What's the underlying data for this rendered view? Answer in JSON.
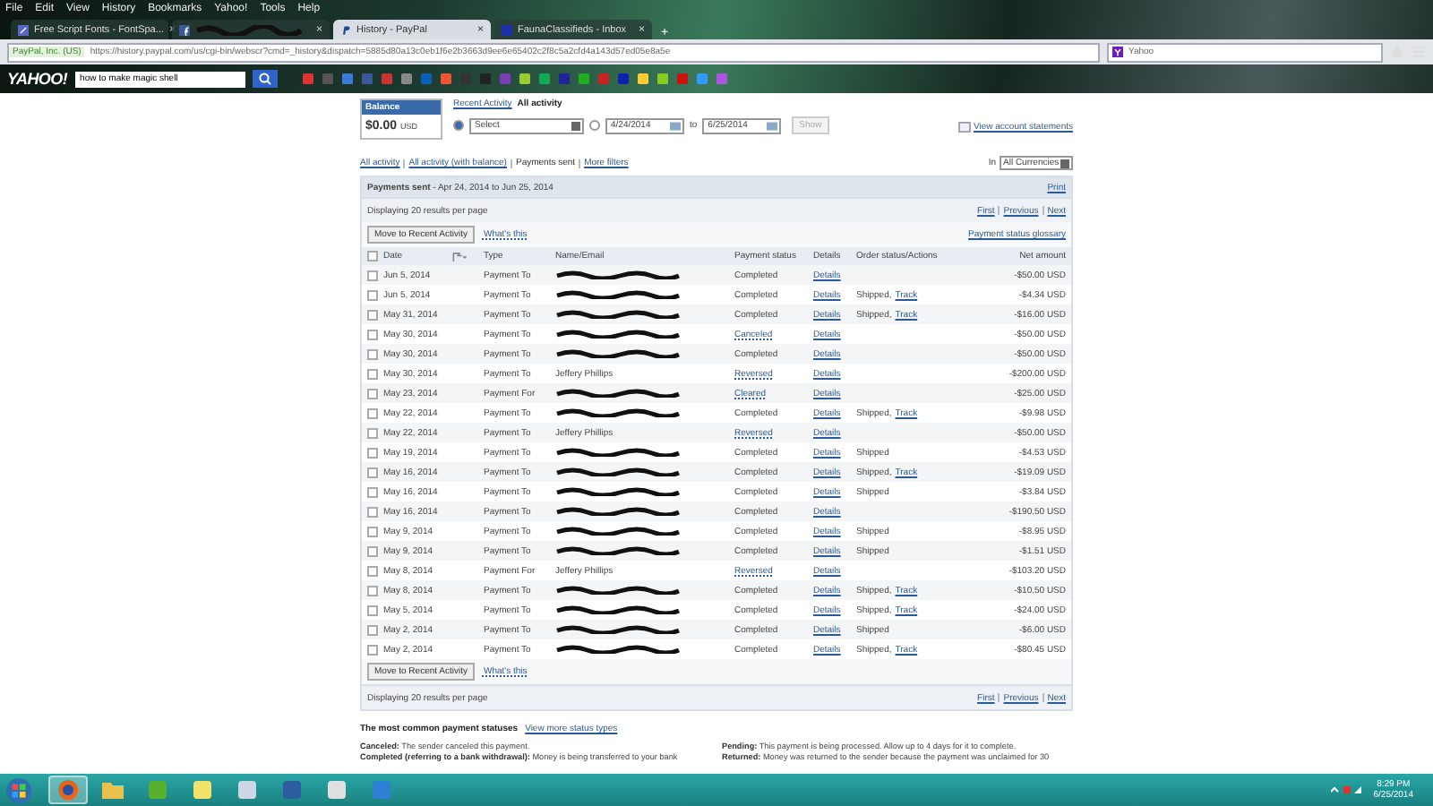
{
  "browser": {
    "menu": [
      "File",
      "Edit",
      "View",
      "History",
      "Bookmarks",
      "Yahoo!",
      "Tools",
      "Help"
    ],
    "tabs": [
      {
        "kind": "font",
        "title": "Free Script Fonts - FontSpa...",
        "redacted": false,
        "selected": false,
        "close": "×"
      },
      {
        "kind": "facebook",
        "redacted": true,
        "selected": false,
        "close": "×"
      },
      {
        "kind": "paypal",
        "title": "History - PayPal",
        "redacted": false,
        "selected": true,
        "close": "×"
      },
      {
        "kind": "mail",
        "title": "FaunaClassifieds - Inbox",
        "redacted": false,
        "selected": false,
        "close": "×"
      }
    ],
    "new_tab": "+",
    "identity": "PayPal, Inc. (US)",
    "url": "https://history.paypal.com/us/cgi-bin/webscr?cmd=_history&dispatch=5885d80a13c0eb1f6e2b3663d9ee6e65402c2f8c5a2cfd4a143d57ed05e8a5e",
    "search": "Yahoo"
  },
  "toolbar": {
    "logo": "YAHOO!",
    "search_value": "how to make magic shell"
  },
  "page": {
    "balance": {
      "label": "Balance",
      "amount": "$0.00",
      "currency": "USD"
    },
    "views": [
      {
        "label": "Recent Activity",
        "selected": false
      },
      {
        "label": "All activity",
        "selected": true
      }
    ],
    "period": {
      "selected": true,
      "value": "Select"
    },
    "date_range": {
      "selected": false,
      "from": "4/24/2014",
      "to_label": "to",
      "to": "6/25/2014"
    },
    "show_button": "Show",
    "statements_link": "View account statements",
    "filters": [
      {
        "label": "All activity",
        "selected": false
      },
      {
        "label": "All activity (with balance)",
        "selected": false
      },
      {
        "label": "Payments sent",
        "selected": true
      },
      {
        "label": "More filters",
        "selected": false
      }
    ],
    "currency_label": "In",
    "currency": "All Currencies",
    "section_title": "Payments sent",
    "section_range": "- Apr 24, 2014 to Jun 25, 2014",
    "print": "Print",
    "top_pager": {
      "per_page": "Displaying 20 results per page",
      "links": [
        "First",
        "Previous",
        "Next"
      ]
    },
    "top_actions": {
      "move_button": "Move to Recent Activity",
      "whats_this": "What's this",
      "glossary": "Payment status glossary"
    },
    "columns": [
      "Date",
      "Type",
      "Name/Email",
      "Payment status",
      "Details",
      "Order status/Actions",
      "Net amount"
    ],
    "select_all_checked": false,
    "rows": [
      {
        "checked": false,
        "date": "Jun 5, 2014",
        "type": "Payment To",
        "redacted": true,
        "status": "Completed",
        "status_link": false,
        "details": "Details",
        "amount": "-$50.00 USD"
      },
      {
        "checked": false,
        "date": "Jun 5, 2014",
        "type": "Payment To",
        "redacted": true,
        "status": "Completed",
        "status_link": false,
        "details": "Details",
        "order": "Shipped,",
        "track": "Track",
        "amount": "-$4.34 USD"
      },
      {
        "checked": false,
        "date": "May 31, 2014",
        "type": "Payment To",
        "redacted": true,
        "status": "Completed",
        "status_link": false,
        "details": "Details",
        "order": "Shipped,",
        "track": "Track",
        "amount": "-$16.00 USD"
      },
      {
        "checked": false,
        "date": "May 30, 2014",
        "type": "Payment To",
        "redacted": true,
        "status": "Canceled",
        "status_link": true,
        "details": "Details",
        "amount": "-$50.00 USD"
      },
      {
        "checked": false,
        "date": "May 30, 2014",
        "type": "Payment To",
        "redacted": true,
        "status": "Completed",
        "status_link": false,
        "details": "Details",
        "amount": "-$50.00 USD"
      },
      {
        "checked": false,
        "date": "May 30, 2014",
        "type": "Payment To",
        "name": "Jeffery Phillips",
        "redacted": false,
        "status": "Reversed",
        "status_link": true,
        "details": "Details",
        "amount": "-$200.00 USD"
      },
      {
        "checked": false,
        "date": "May 23, 2014",
        "type": "Payment For",
        "redacted": true,
        "status": "Cleared",
        "status_link": true,
        "details": "Details",
        "amount": "-$25.00 USD"
      },
      {
        "checked": false,
        "date": "May 22, 2014",
        "type": "Payment To",
        "redacted": true,
        "status": "Completed",
        "status_link": false,
        "details": "Details",
        "order": "Shipped,",
        "track": "Track",
        "amount": "-$9.98 USD"
      },
      {
        "checked": false,
        "date": "May 22, 2014",
        "type": "Payment To",
        "name": "Jeffery Phillips",
        "redacted": false,
        "status": "Reversed",
        "status_link": true,
        "details": "Details",
        "amount": "-$50.00 USD"
      },
      {
        "checked": false,
        "date": "May 19, 2014",
        "type": "Payment To",
        "redacted": true,
        "status": "Completed",
        "status_link": false,
        "details": "Details",
        "order": "Shipped",
        "amount": "-$4.53 USD"
      },
      {
        "checked": false,
        "date": "May 16, 2014",
        "type": "Payment To",
        "redacted": true,
        "status": "Completed",
        "status_link": false,
        "details": "Details",
        "order": "Shipped,",
        "track": "Track",
        "amount": "-$19.09 USD"
      },
      {
        "checked": false,
        "date": "May 16, 2014",
        "type": "Payment To",
        "redacted": true,
        "status": "Completed",
        "status_link": false,
        "details": "Details",
        "order": "Shipped",
        "amount": "-$3.84 USD"
      },
      {
        "checked": false,
        "date": "May 16, 2014",
        "type": "Payment To",
        "redacted": true,
        "status": "Completed",
        "status_link": false,
        "details": "Details",
        "amount": "-$190.50 USD"
      },
      {
        "checked": false,
        "date": "May 9, 2014",
        "type": "Payment To",
        "redacted": true,
        "status": "Completed",
        "status_link": false,
        "details": "Details",
        "order": "Shipped",
        "amount": "-$8.95 USD"
      },
      {
        "checked": false,
        "date": "May 9, 2014",
        "type": "Payment To",
        "redacted": true,
        "status": "Completed",
        "status_link": false,
        "details": "Details",
        "order": "Shipped",
        "amount": "-$1.51 USD"
      },
      {
        "checked": false,
        "date": "May 8, 2014",
        "type": "Payment For",
        "name": "Jeffery Phillips",
        "redacted": false,
        "status": "Reversed",
        "status_link": true,
        "details": "Details",
        "amount": "-$103.20 USD"
      },
      {
        "checked": false,
        "date": "May 8, 2014",
        "type": "Payment To",
        "redacted": true,
        "status": "Completed",
        "status_link": false,
        "details": "Details",
        "order": "Shipped,",
        "track": "Track",
        "amount": "-$10.50 USD"
      },
      {
        "checked": false,
        "date": "May 5, 2014",
        "type": "Payment To",
        "redacted": true,
        "status": "Completed",
        "status_link": false,
        "details": "Details",
        "order": "Shipped,",
        "track": "Track",
        "amount": "-$24.00 USD"
      },
      {
        "checked": false,
        "date": "May 2, 2014",
        "type": "Payment To",
        "redacted": true,
        "status": "Completed",
        "status_link": false,
        "details": "Details",
        "order": "Shipped",
        "amount": "-$6.00 USD"
      },
      {
        "checked": false,
        "date": "May 2, 2014",
        "type": "Payment To",
        "redacted": true,
        "status": "Completed",
        "status_link": false,
        "details": "Details",
        "order": "Shipped,",
        "track": "Track",
        "amount": "-$80.45 USD"
      }
    ],
    "bottom_actions": {
      "move_button": "Move to Recent Activity",
      "whats_this": "What's this"
    },
    "bottom_pager": {
      "per_page": "Displaying 20 results per page",
      "links": [
        "First",
        "Previous",
        "Next"
      ]
    },
    "statuses_title": "The most common payment statuses",
    "statuses_link": "View more status types",
    "statuses": [
      [
        "**Canceled:** The sender canceled this payment.",
        "**Completed (referring to a bank withdrawal):** Money is being transferred to your bank"
      ],
      [
        "**Pending:** This payment is being processed. Allow up to 4 days for it to complete.",
        "**Returned:** Money was returned to the sender because the payment was unclaimed for 30"
      ]
    ]
  },
  "taskbar": {
    "apps": [
      {
        "kind": "firefox",
        "selected": true
      },
      {
        "kind": "folder",
        "selected": false
      },
      {
        "kind": "torrent",
        "selected": false
      },
      {
        "kind": "notes",
        "selected": false
      },
      {
        "kind": "calculator",
        "selected": false
      },
      {
        "kind": "media",
        "selected": false
      },
      {
        "kind": "cards",
        "selected": false
      },
      {
        "kind": "app",
        "selected": false
      }
    ],
    "time": "8:29 PM",
    "date": "6/25/2014"
  }
}
